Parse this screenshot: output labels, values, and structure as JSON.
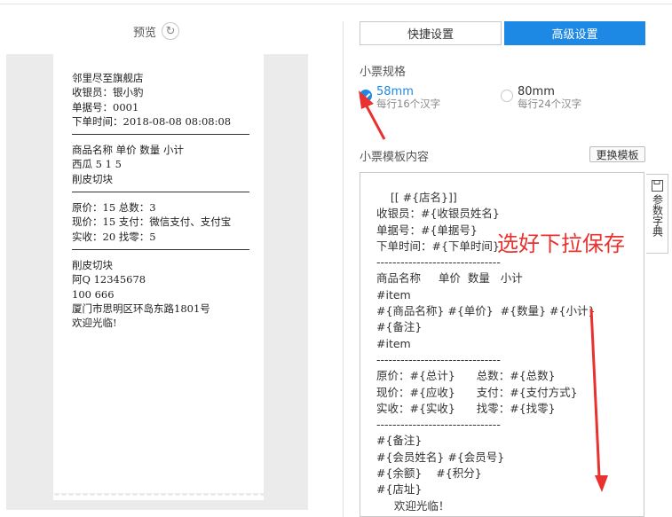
{
  "preview": {
    "title": "预览",
    "receipt_lines": [
      "邻里尽至旗舰店",
      "收银员：银小豹",
      "单据号：0001",
      "下单时间：2018-08-08 08:08:08",
      "---",
      "商品名称 单价 数量 小计",
      "西瓜 5 1 5",
      "削皮切块",
      "---",
      "原价：15 总数：3",
      "现价：15 支付：微信支付、支付宝",
      "实收：20 找零：5",
      "---",
      "削皮切块",
      "阿Q 12345678",
      "100 666",
      "厦门市思明区环岛东路1801号",
      "欢迎光临!"
    ]
  },
  "tabs": {
    "quick": "快捷设置",
    "advanced": "高级设置"
  },
  "spec": {
    "title": "小票规格",
    "options": [
      {
        "label": "58mm",
        "sub": "每行16个汉字",
        "selected": true
      },
      {
        "label": "80mm",
        "sub": "每行24个汉字",
        "selected": false
      }
    ]
  },
  "template": {
    "title": "小票模板内容",
    "swap_button": "更换模板",
    "dict_label": "参数字典",
    "lines": [
      "    [[ #{店名}]]",
      "收银员：#{收银员姓名}",
      "单据号：#{单据号}",
      "下单时间：#{下单时间}",
      "-------------------------------",
      "商品名称     单价  数量   小计",
      "#item",
      "#{商品名称} #{单价}  #{数量} #{小计}",
      "#{备注}",
      "#item",
      "-------------------------------",
      "原价：#{总计}      总数：#{总数}",
      "现价：#{应收}      支付：#{支付方式}",
      "实收：#{实收}      找零：#{找零}",
      "-------------------------------",
      "#{备注}",
      "#{会员姓名} #{会员号}",
      "#{余额}    #{积分}",
      "#{店址}",
      "     欢迎光临！"
    ]
  },
  "annotation": {
    "text": "选好下拉保存",
    "color": "#e8322f"
  },
  "colors": {
    "accent": "#1e88e5"
  }
}
